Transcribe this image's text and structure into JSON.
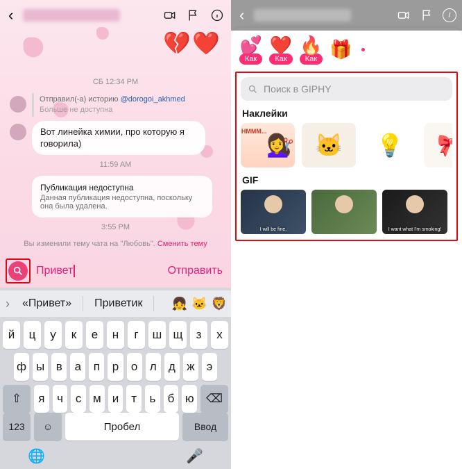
{
  "left": {
    "header": {
      "big_heart_broken": "💔",
      "big_heart": "❤️"
    },
    "ts1": "СБ 12:34 PM",
    "reply": {
      "line1_a": "Отправил(-а) историю ",
      "mention": "@dorogoi_akhmed",
      "line2": "Больше не доступна"
    },
    "msg1": "Вот линейка химии, про которую я говорила)",
    "ts2": "11:59 AM",
    "syscard": {
      "h": "Публикация недоступна",
      "b": "Данная публикация недоступна, поскольку она была удалена."
    },
    "ts3": "3:55 PM",
    "theme_a": "Вы изменили тему чата на \"Любовь\". ",
    "theme_link": "Сменить тему",
    "compose_value": "Привет",
    "send": "Отправить",
    "sugg": {
      "w1": "«Привет»",
      "w2": "Приветик",
      "e1": "👧",
      "e2": "🐱",
      "e3": "🦁"
    },
    "rows": {
      "r1": [
        "й",
        "ц",
        "у",
        "к",
        "е",
        "н",
        "г",
        "ш",
        "щ",
        "з",
        "х"
      ],
      "r2": [
        "ф",
        "ы",
        "в",
        "а",
        "п",
        "р",
        "о",
        "л",
        "д",
        "ж",
        "э"
      ],
      "r3": [
        "я",
        "ч",
        "с",
        "м",
        "и",
        "т",
        "ь",
        "б",
        "ю"
      ]
    },
    "mods": {
      "num": "123",
      "space": "Пробел",
      "enter": "Ввод",
      "globe": "🌐",
      "mic": "🎤"
    }
  },
  "right": {
    "react_label": "Как",
    "search_placeholder": "Поиск в GIPHY",
    "stickers_h": "Наклейки",
    "sticker_hmmm": "HMMM...",
    "gif_h": "GIF",
    "gif_caps": [
      "I will be fine.",
      "",
      "I want what I'm smoking!"
    ]
  }
}
